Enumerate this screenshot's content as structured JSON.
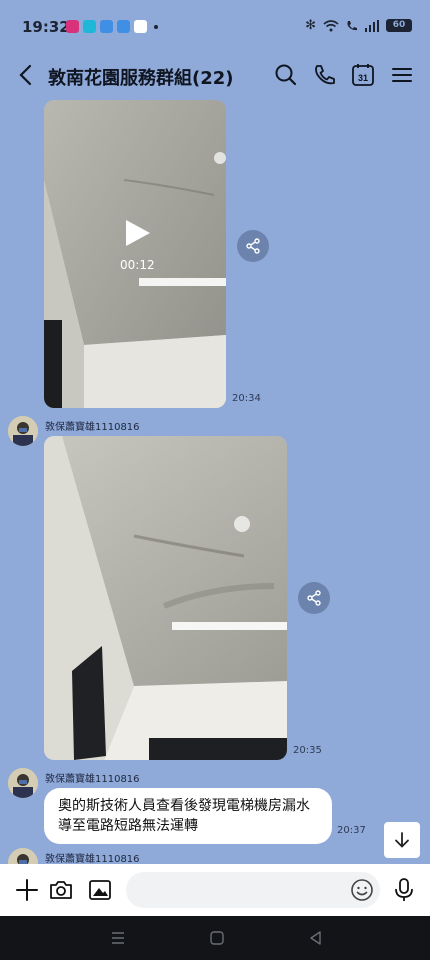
{
  "status": {
    "time": "19:32",
    "battery": "60"
  },
  "header": {
    "title": "敦南花園服務群組(22)"
  },
  "messages": {
    "video1": {
      "duration": "00:12",
      "time": "20:34"
    },
    "sender1": "敦保蕭寶雄1110816",
    "image2": {
      "time": "20:35"
    },
    "sender2": "敦保蕭寶雄1110816",
    "text3": {
      "body": "奧的斯技術人員查看後發現電梯機房漏水導至電路短路無法運轉",
      "time": "20:37"
    },
    "sender3": "敦保蕭寶雄1110816"
  },
  "input": {
    "placeholder": ""
  },
  "colors": {
    "chat_background": "#8fa9d8",
    "bubble": "#ffffff",
    "nav_bar": "#121418"
  },
  "icons": [
    "back-icon",
    "search-icon",
    "phone-icon",
    "calendar-icon",
    "menu-icon",
    "play-icon",
    "share-icon",
    "arrow-down-icon",
    "plus-icon",
    "camera-icon",
    "image-icon",
    "emoji-icon",
    "mic-icon"
  ]
}
